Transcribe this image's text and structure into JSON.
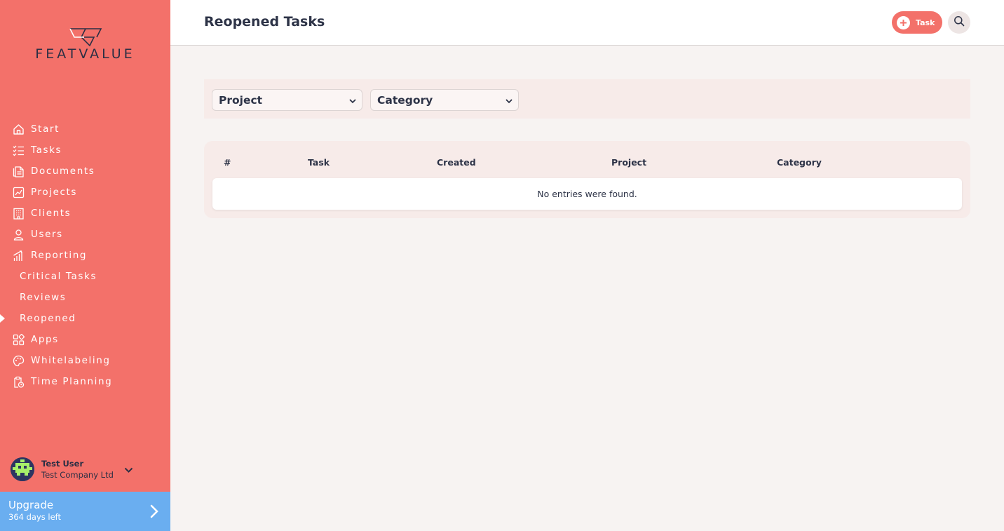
{
  "brand": {
    "name": "FEATVALUE"
  },
  "sidebar": {
    "items": [
      {
        "label": "Start",
        "icon": "home-icon"
      },
      {
        "label": "Tasks",
        "icon": "checklist-icon"
      },
      {
        "label": "Documents",
        "icon": "document-icon"
      },
      {
        "label": "Projects",
        "icon": "chart-icon"
      },
      {
        "label": "Clients",
        "icon": "building-icon"
      },
      {
        "label": "Users",
        "icon": "user-icon"
      },
      {
        "label": "Reporting",
        "icon": "bar-chart-icon"
      },
      {
        "label": "Critical Tasks",
        "sub": true
      },
      {
        "label": "Reviews",
        "sub": true
      },
      {
        "label": "Reopened",
        "sub": true,
        "active": true
      },
      {
        "label": "Apps",
        "icon": "apps-icon"
      },
      {
        "label": "Whitelabeling",
        "icon": "palette-icon"
      },
      {
        "label": "Time Planning",
        "icon": "clipboard-clock-icon"
      }
    ],
    "user": {
      "name": "Test User",
      "company": "Test Company Ltd"
    },
    "upgrade": {
      "title": "Upgrade",
      "subtitle": "364 days left"
    }
  },
  "header": {
    "title": "Reopened Tasks",
    "task_button_label": "Task"
  },
  "filters": {
    "project_label": "Project",
    "category_label": "Category"
  },
  "table": {
    "columns": [
      "#",
      "Task",
      "Created",
      "Project",
      "Category"
    ],
    "empty_message": "No entries were found."
  },
  "colors": {
    "sidebar_bg": "#f3716a",
    "upgrade_bg": "#6aaef0",
    "text_dark": "#2d3347",
    "page_bg": "#f7f3f2"
  }
}
